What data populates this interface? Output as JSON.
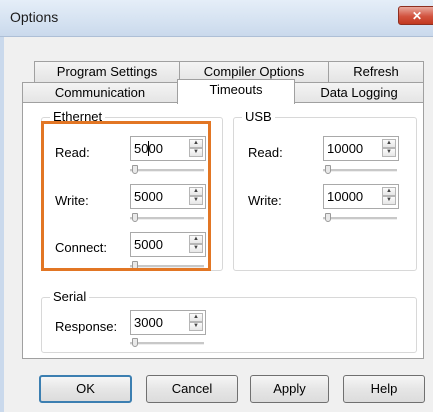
{
  "window": {
    "title": "Options",
    "close_glyph": "✕"
  },
  "tabs": {
    "row_back": [
      "Program Settings",
      "Compiler Options",
      "Refresh"
    ],
    "row_front": [
      "Communication",
      "Timeouts",
      "Data Logging"
    ],
    "active": "Timeouts"
  },
  "ethernet": {
    "title": "Ethernet",
    "read": {
      "label": "Read:",
      "value": "5000"
    },
    "write": {
      "label": "Write:",
      "value": "5000"
    },
    "connect": {
      "label": "Connect:",
      "value": "5000"
    }
  },
  "usb": {
    "title": "USB",
    "read": {
      "label": "Read:",
      "value": "10000"
    },
    "write": {
      "label": "Write:",
      "value": "10000"
    }
  },
  "serial": {
    "title": "Serial",
    "response": {
      "label": "Response:",
      "value": "3000"
    }
  },
  "buttons": {
    "ok": "OK",
    "cancel": "Cancel",
    "apply": "Apply",
    "help": "Help"
  },
  "colors": {
    "highlight": "#e27624",
    "close": "#c2381f"
  }
}
